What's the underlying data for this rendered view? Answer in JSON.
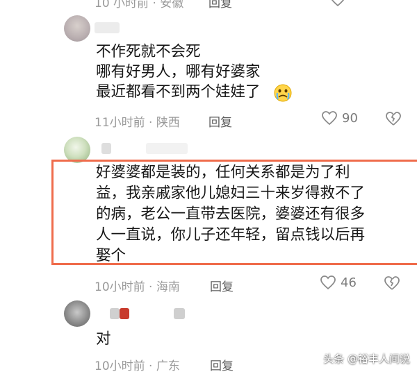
{
  "top_partial": {
    "meta": "10 小时前 · 安徽",
    "reply": "回复"
  },
  "comments": [
    {
      "lines": [
        "不作死就不会死",
        "哪有好男人，哪有好婆家",
        "最近都看不到两个娃娃了"
      ],
      "meta": "11小时前 · 陕西",
      "reply": "回复",
      "likes": "90"
    },
    {
      "lines": [
        "好婆婆都是装的，任何关系都是为了利",
        "益，我亲戚家他儿媳妇三十来岁得救不了",
        "的病，老公一直带去医院，婆婆还有很多",
        "人一直说，你儿子还年轻，留点钱以后再",
        "娶个"
      ],
      "meta": "10小时前 · 海南",
      "reply": "回复",
      "likes": "46"
    },
    {
      "lines": [
        "对"
      ],
      "meta": "10小时前 · 广东",
      "reply": "回复"
    }
  ],
  "watermark": "头条 @裕丰人间说",
  "colors": {
    "highlight": "#ef6c4c",
    "meta": "#9a9a9a",
    "text": "#161616"
  },
  "icons": [
    "avatar",
    "crying-emoji-icon",
    "heart-outline-icon",
    "broken-heart-icon"
  ]
}
